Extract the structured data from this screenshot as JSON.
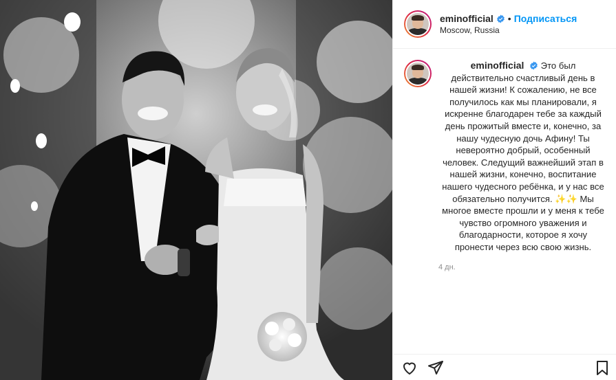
{
  "post": {
    "image_alt": "black and white wedding photo",
    "author": {
      "username": "eminofficial",
      "verified": true,
      "follow_label": "Подписаться",
      "separator": "•",
      "location": "Moscow, Russia"
    },
    "caption": {
      "username": "eminofficial",
      "text": "Это был действительно счастливый день в нашей жизни! К сожалению, не все получилось как мы планировали, я искренне благодарен тебе за каждый день прожитый вместе и, конечно, за нашу чудесную дочь Афину! Ты невероятно добрый, особенный человек. Следущий важнейший этап в нашей жизни, конечно, воспитание нашего чудесного ребёнка, и у нас все обязательно получится. ✨✨ Мы многое вместе прошли и у меня к тебе чувство огромного уважения и благодарности, которое я хочу пронести через всю свою жизнь.",
      "time": "4 дн."
    },
    "actions": {
      "icons": [
        "heart-icon",
        "share-icon",
        "bookmark-icon"
      ]
    },
    "colors": {
      "accent": "#0095f6",
      "verified": "#3897f0",
      "text": "#262626",
      "muted": "#8e8e8e"
    }
  }
}
